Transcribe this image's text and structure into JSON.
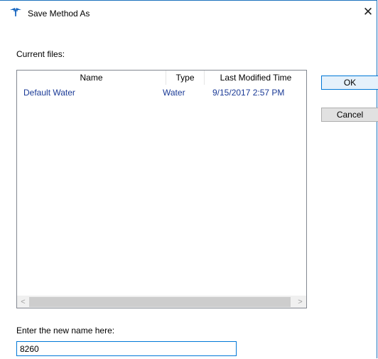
{
  "window": {
    "title": "Save Method As",
    "close_glyph": "✕"
  },
  "current_files_label": "Current files:",
  "file_list": {
    "columns": [
      "Name",
      "Type",
      "Last Modified Time"
    ],
    "rows": [
      {
        "name": "Default Water",
        "type": "Water",
        "modified": "9/15/2017 2:57 PM"
      }
    ],
    "scroll_left_glyph": "<",
    "scroll_right_glyph": ">"
  },
  "buttons": {
    "ok_label": "OK",
    "cancel_label": "Cancel"
  },
  "new_name": {
    "label": "Enter the new name here:",
    "value": "8260"
  },
  "colors": {
    "accent": "#0078d7",
    "list_text": "#1a3a96",
    "app_icon": "#1565c0"
  },
  "icons": {
    "app": "teledyne-logo-icon",
    "close": "close-icon"
  }
}
